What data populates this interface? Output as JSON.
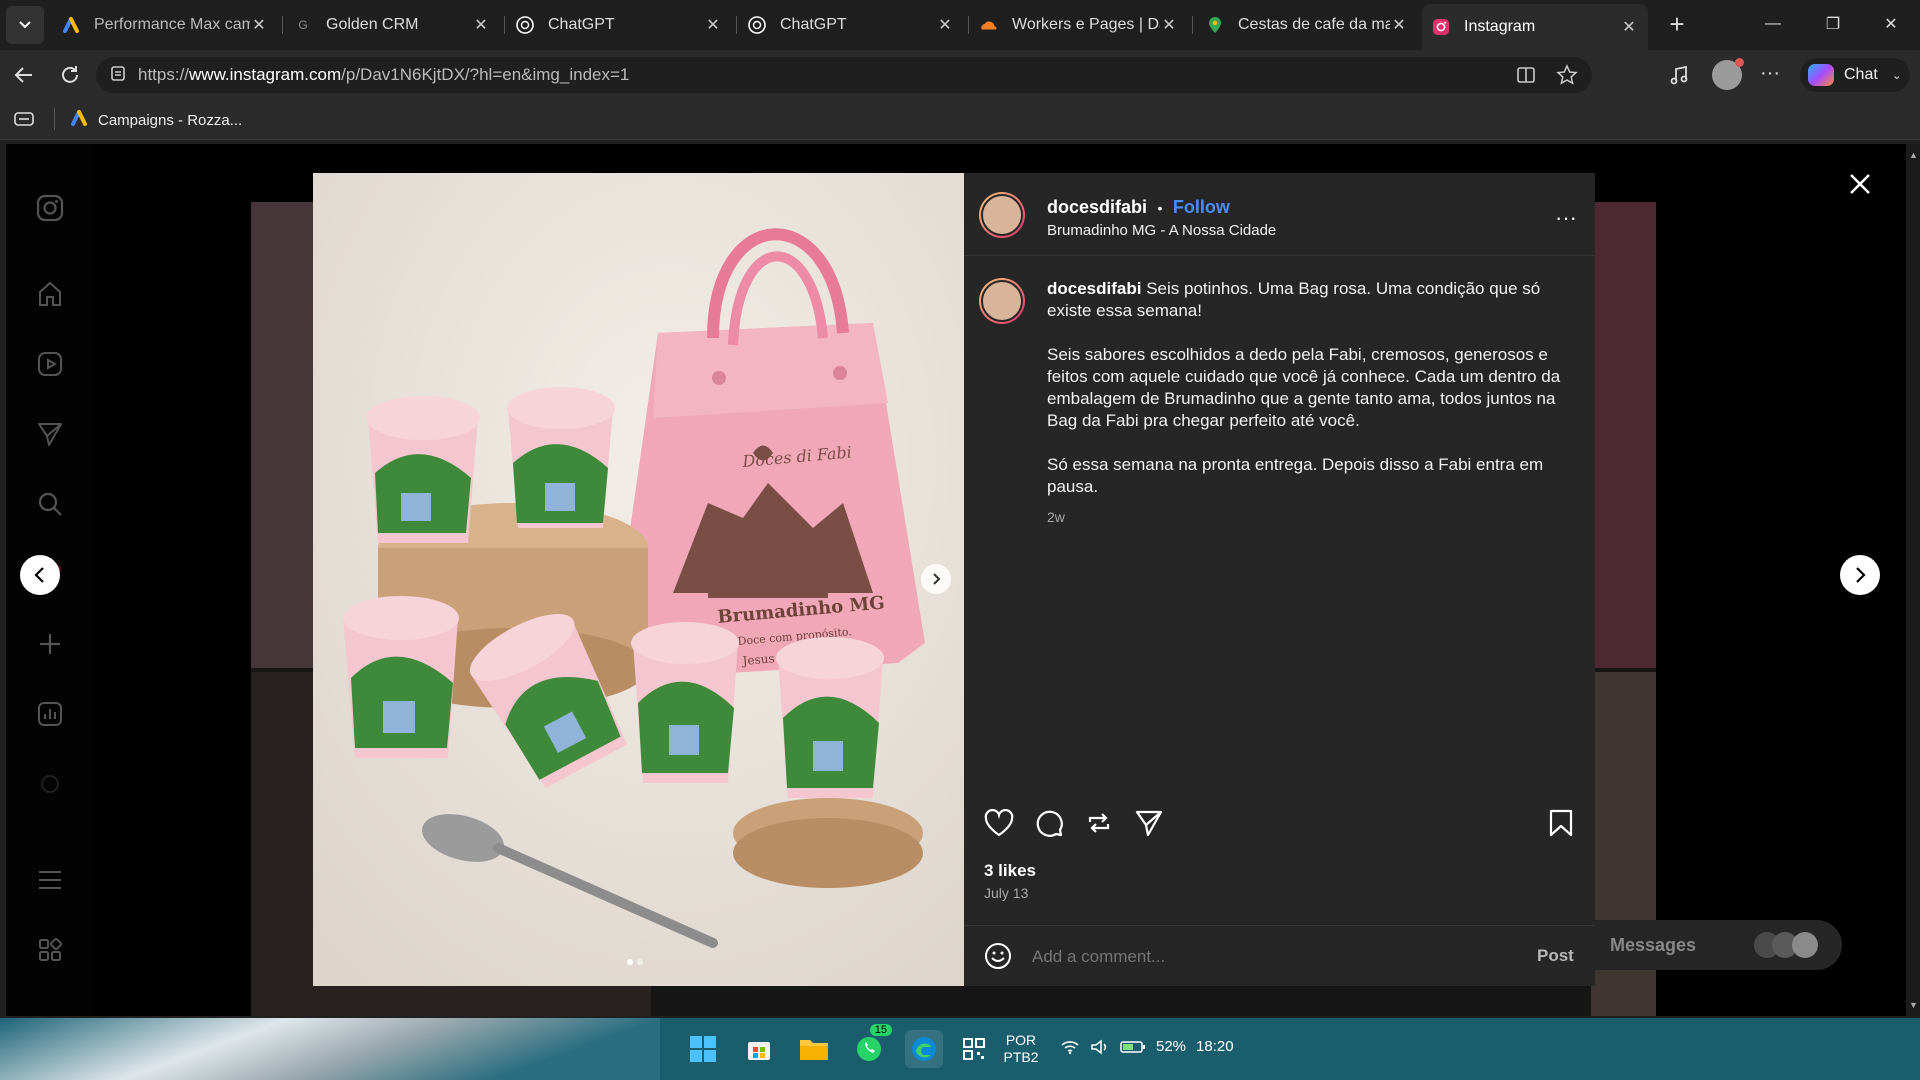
{
  "browser": {
    "tabs": [
      {
        "label": "Performance Max camp",
        "icon": "google-ads-icon"
      },
      {
        "label": "Golden CRM",
        "icon": "crm-icon"
      },
      {
        "label": "ChatGPT",
        "icon": "chatgpt-icon"
      },
      {
        "label": "ChatGPT",
        "icon": "chatgpt-icon"
      },
      {
        "label": "Workers e Pages | Danie",
        "icon": "cloudflare-icon"
      },
      {
        "label": "Cestas de cafe da manh",
        "icon": "maps-pin-icon"
      },
      {
        "label": "Instagram",
        "icon": "instagram-icon"
      }
    ],
    "url_prefix": "https://",
    "url_domain": "www.instagram.com",
    "url_path": "/p/Dav1N6KjtDX/?hl=en&img_index=1",
    "copilot_label": "Chat",
    "bookmark": "Campaigns - Rozza..."
  },
  "post": {
    "username": "docesdifabi",
    "follow_label": "Follow",
    "location": "Brumadinho MG - A Nossa Cidade",
    "caption_user": "docesdifabi",
    "caption_p1": "Seis potinhos. Uma Bag rosa. Uma condição que só existe essa semana!",
    "caption_p2": "Seis sabores escolhidos a dedo pela Fabi, cremosos, generosos e feitos com aquele cuidado que você já conhece. Cada um dentro da embalagem de Brumadinho que a gente tanto ama, todos juntos na Bag da Fabi pra chegar perfeito até você.",
    "caption_p3": "Só essa semana na pronta entrega. Depois disso a Fabi entra em pausa.",
    "age": "2w",
    "likes": "3 likes",
    "date": "July 13",
    "comment_placeholder": "Add a comment...",
    "post_label": "Post"
  },
  "photo": {
    "bag_brand": "Doces di Fabi",
    "bag_city": "Brumadinho MG",
    "bag_line1": "Doce com propósito.",
    "bag_line2": "Jesus é o Senhor"
  },
  "messages": {
    "label": "Messages"
  },
  "taskbar": {
    "lang1": "POR",
    "lang2": "PTB2",
    "battery": "52%",
    "time": "18:20",
    "whatsapp_badge": "15"
  },
  "colors": {
    "accent_link": "#4a8cff",
    "instagram_bg": "#000000",
    "panel": "#262626"
  }
}
